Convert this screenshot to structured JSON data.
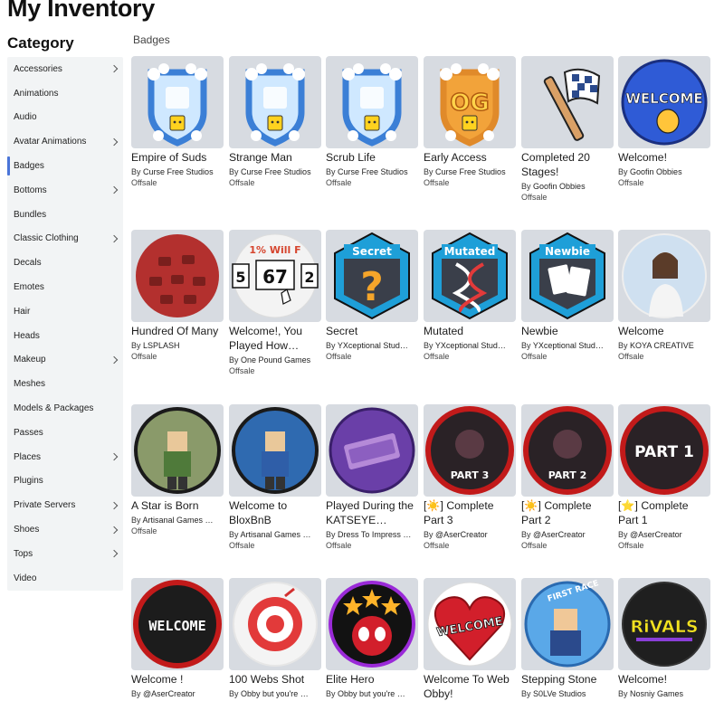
{
  "page": {
    "title": "My Inventory"
  },
  "sidebar": {
    "heading": "Category",
    "items": [
      {
        "label": "Accessories",
        "chevron": true
      },
      {
        "label": "Animations",
        "chevron": false
      },
      {
        "label": "Audio",
        "chevron": false
      },
      {
        "label": "Avatar Animations",
        "chevron": true
      },
      {
        "label": "Badges",
        "chevron": false,
        "active": true
      },
      {
        "label": "Bottoms",
        "chevron": true
      },
      {
        "label": "Bundles",
        "chevron": false
      },
      {
        "label": "Classic Clothing",
        "chevron": true
      },
      {
        "label": "Decals",
        "chevron": false
      },
      {
        "label": "Emotes",
        "chevron": false
      },
      {
        "label": "Hair",
        "chevron": false
      },
      {
        "label": "Heads",
        "chevron": false
      },
      {
        "label": "Makeup",
        "chevron": true
      },
      {
        "label": "Meshes",
        "chevron": false
      },
      {
        "label": "Models & Packages",
        "chevron": false
      },
      {
        "label": "Passes",
        "chevron": false
      },
      {
        "label": "Places",
        "chevron": true
      },
      {
        "label": "Plugins",
        "chevron": false
      },
      {
        "label": "Private Servers",
        "chevron": true
      },
      {
        "label": "Shoes",
        "chevron": true
      },
      {
        "label": "Tops",
        "chevron": true
      },
      {
        "label": "Video",
        "chevron": false
      }
    ]
  },
  "main": {
    "section_title": "Badges",
    "by_prefix": "By",
    "badges": [
      {
        "name": "Empire of Suds",
        "creator": "Curse Free Studios",
        "status": "Offsale",
        "icon": "suds-shield-icon",
        "color": "#3b7fd6"
      },
      {
        "name": "Strange Man",
        "creator": "Curse Free Studios",
        "status": "Offsale",
        "icon": "suds-shield-icon",
        "color": "#3b7fd6"
      },
      {
        "name": "Scrub Life",
        "creator": "Curse Free Studios",
        "status": "Offsale",
        "icon": "suds-shield-icon",
        "color": "#3b7fd6"
      },
      {
        "name": "Early Access",
        "creator": "Curse Free Studios",
        "status": "Offsale",
        "icon": "og-shield-icon",
        "color": "#e08a2a"
      },
      {
        "name": "Completed 20 Stages!",
        "creator": "Goofin Obbies",
        "status": "Offsale",
        "icon": "checkered-flag-icon",
        "color": "#2b4a8c"
      },
      {
        "name": "Welcome!",
        "creator": "Goofin Obbies",
        "status": "Offsale",
        "icon": "welcome-wave-icon",
        "color": "#2f5bd6"
      },
      {
        "name": "Hundred Of Many",
        "creator": "LSPLASH",
        "status": "Offsale",
        "icon": "red-pattern-icon",
        "color": "#b3302e"
      },
      {
        "name": "Welcome!, You Played How…",
        "creator": "One Pound Games",
        "status": "Offsale",
        "icon": "number-cards-icon",
        "color": "#d6452e",
        "text_main": "5 67 2",
        "text_top": "1% Will F"
      },
      {
        "name": "Secret",
        "creator": "YXceptional Stud…",
        "status": "Offsale",
        "icon": "question-mark-icon",
        "color": "#1e9fd8",
        "label": "Secret"
      },
      {
        "name": "Mutated",
        "creator": "YXceptional Stud…",
        "status": "Offsale",
        "icon": "dna-icon",
        "color": "#1e9fd8",
        "label": "Mutated"
      },
      {
        "name": "Newbie",
        "creator": "YXceptional Stud…",
        "status": "Offsale",
        "icon": "cards-icon",
        "color": "#1e9fd8",
        "label": "Newbie"
      },
      {
        "name": "Welcome",
        "creator": "KOYA CREATIVE",
        "status": "Offsale",
        "icon": "avatar-portrait-icon",
        "color": "#9fbcd8"
      },
      {
        "name": "A Star is Born",
        "creator": "Artisanal Games …",
        "status": "Offsale",
        "icon": "avatar-scene-icon",
        "color": "#8a9a6a"
      },
      {
        "name": "Welcome to BloxBnB",
        "creator": "Artisanal Games …",
        "status": "Offsale",
        "icon": "avatar-scene-icon",
        "color": "#2f6ab0"
      },
      {
        "name": "Played During the KATSEYE…",
        "creator": "Dress To Impress …",
        "status": "Offsale",
        "icon": "ticket-icon",
        "color": "#6a3fa8"
      },
      {
        "name": "[☀️] Complete Part 3",
        "creator": "@AserCreator",
        "status": "Offsale",
        "icon": "horror-part-icon",
        "color": "#c21a1a",
        "label": "PART 3"
      },
      {
        "name": "[☀️] Complete Part 2",
        "creator": "@AserCreator",
        "status": "Offsale",
        "icon": "horror-part-icon",
        "color": "#c21a1a",
        "label": "PART 2"
      },
      {
        "name": "[⭐] Complete Part 1",
        "creator": "@AserCreator",
        "status": "Offsale",
        "icon": "horror-part-icon",
        "color": "#c21a1a",
        "label": "PART 1"
      },
      {
        "name": "Welcome !",
        "creator": "@AserCreator",
        "status": "",
        "icon": "welcome-dark-icon",
        "color": "#c21a1a",
        "label": "WELCOME"
      },
      {
        "name": "100 Webs Shot",
        "creator": "Obby but you're …",
        "status": "",
        "icon": "target-icon",
        "color": "#e23a3a"
      },
      {
        "name": "Elite Hero",
        "creator": "Obby but you're …",
        "status": "",
        "icon": "hero-stars-icon",
        "color": "#9a2ad8"
      },
      {
        "name": "Welcome To Web Obby!",
        "creator": "S0LVe Studios",
        "status": "",
        "icon": "heart-welcome-icon",
        "color": "#d21f2b",
        "label": "WELCOME"
      },
      {
        "name": "Stepping Stone",
        "creator": "S0LVe Studios",
        "status": "",
        "icon": "avatar-race-icon",
        "color": "#2b8ad8",
        "label": "FIRST RACE"
      },
      {
        "name": "Welcome!",
        "creator": "Nosniy Games",
        "status": "",
        "icon": "rivals-logo-icon",
        "color": "#1f1f1f",
        "label": "RiVALS"
      }
    ]
  }
}
